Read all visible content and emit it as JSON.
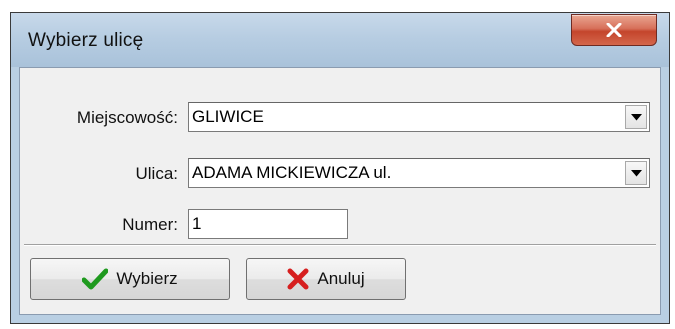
{
  "window": {
    "title": "Wybierz ulicę",
    "close_icon": "close-x-icon"
  },
  "form": {
    "miejscowosc": {
      "label": "Miejscowość:",
      "value": "GLIWICE"
    },
    "ulica": {
      "label": "Ulica:",
      "value": "ADAMA MICKIEWICZA ul."
    },
    "numer": {
      "label": "Numer:",
      "value": "1"
    }
  },
  "buttons": {
    "ok": {
      "label": "Wybierz",
      "icon": "checkmark-icon",
      "icon_color": "#1f9a1f"
    },
    "cancel": {
      "label": "Anuluj",
      "icon": "red-x-icon",
      "icon_color": "#d61f1f"
    }
  }
}
